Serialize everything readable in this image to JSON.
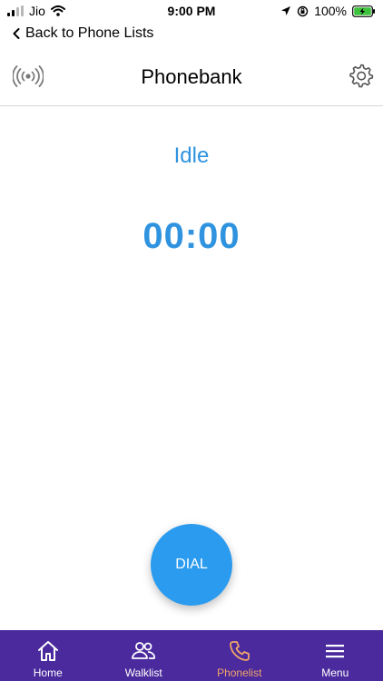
{
  "status_bar": {
    "carrier": "Jio",
    "time": "9:00 PM",
    "battery": "100%"
  },
  "back_link": {
    "label": "Back to Phone Lists"
  },
  "header": {
    "title": "Phonebank"
  },
  "main": {
    "status": "Idle",
    "timer": "00:00",
    "dial_label": "DIAL"
  },
  "nav": {
    "items": [
      {
        "label": "Home",
        "icon": "home-icon"
      },
      {
        "label": "Walklist",
        "icon": "users-icon"
      },
      {
        "label": "Phonelist",
        "icon": "phone-icon",
        "active": true
      },
      {
        "label": "Menu",
        "icon": "menu-icon"
      }
    ]
  },
  "colors": {
    "accent": "#2f93df",
    "dial": "#2b9bef",
    "nav_bg": "#4a2a9c",
    "nav_active": "#f2a66a"
  }
}
